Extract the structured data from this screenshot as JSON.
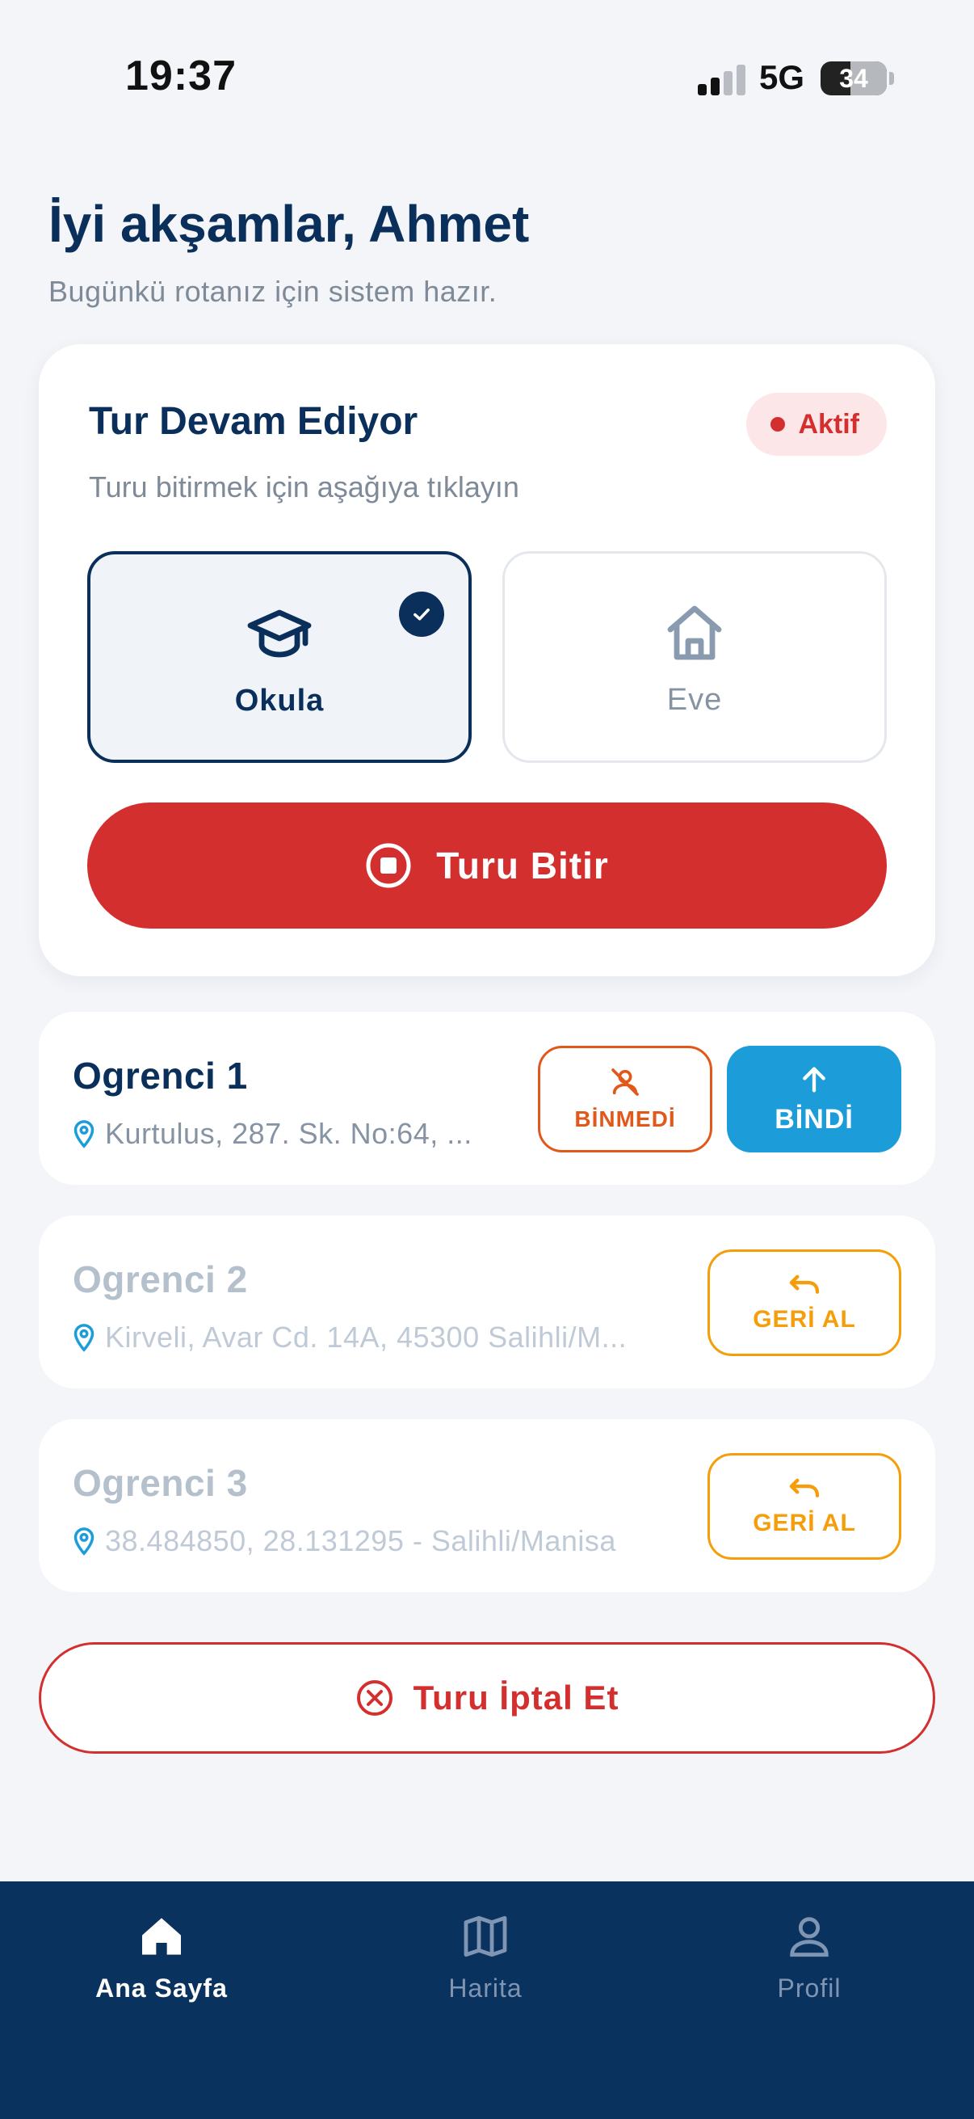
{
  "status_bar": {
    "time": "19:37",
    "network": "5G",
    "battery": "34"
  },
  "header": {
    "greeting": "İyi akşamlar, Ahmet",
    "subtitle": "Bugünkü rotanız için sistem hazır."
  },
  "trip": {
    "title": "Tur Devam Ediyor",
    "hint": "Turu bitirmek için aşağıya tıklayın",
    "status_label": "Aktif",
    "status_color": "#D32F2F",
    "directions": [
      {
        "label": "Okula",
        "icon": "school-icon",
        "selected": true
      },
      {
        "label": "Eve",
        "icon": "home-icon",
        "selected": false
      }
    ],
    "finish_label": "Turu Bitir"
  },
  "students": [
    {
      "name": "Ogrenci 1",
      "address": "Kurtulus, 287. Sk. No:64, ...",
      "actions": {
        "not_boarded": "BİNMEDİ",
        "boarded": "BİNDİ"
      }
    },
    {
      "name": "Ogrenci 2",
      "address": "Kirveli, Avar Cd. 14A, 45300 Salihli/M...",
      "actions": {
        "undo": "GERİ AL"
      }
    },
    {
      "name": "Ogrenci 3",
      "address": "38.484850, 28.131295 - Salihli/Manisa",
      "actions": {
        "undo": "GERİ AL"
      }
    }
  ],
  "cancel_label": "Turu İptal Et",
  "nav": [
    {
      "label": "Ana Sayfa",
      "icon": "home-icon",
      "active": true
    },
    {
      "label": "Harita",
      "icon": "map-icon",
      "active": false
    },
    {
      "label": "Profil",
      "icon": "user-icon",
      "active": false
    }
  ],
  "colors": {
    "primary": "#0B2F5B",
    "danger": "#D32F2F",
    "boarded": "#1C9DD9",
    "not_boarded": "#E2581B",
    "undo": "#F59E0B"
  }
}
